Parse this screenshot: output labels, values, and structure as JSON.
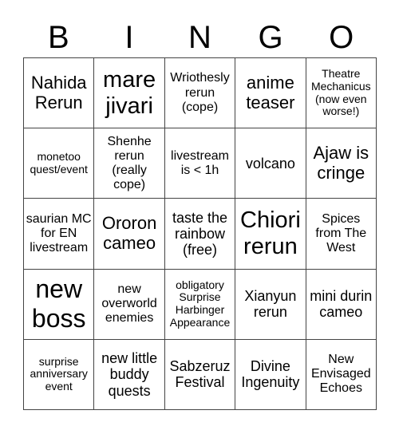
{
  "header": [
    "B",
    "I",
    "N",
    "G",
    "O"
  ],
  "cells": [
    {
      "text": "Nahida Rerun",
      "size": "s4"
    },
    {
      "text": "mare jivari",
      "size": "s5"
    },
    {
      "text": "Wriothesly rerun (cope)",
      "size": "s2"
    },
    {
      "text": "anime teaser",
      "size": "s4"
    },
    {
      "text": "Theatre Mechanicus (now even worse!)",
      "size": "s1"
    },
    {
      "text": "monetoo quest/event",
      "size": "s1"
    },
    {
      "text": "Shenhe rerun (really cope)",
      "size": "s2"
    },
    {
      "text": "livestream is < 1h",
      "size": "s2"
    },
    {
      "text": "volcano",
      "size": "s3"
    },
    {
      "text": "Ajaw is cringe",
      "size": "s4"
    },
    {
      "text": "saurian MC for EN livestream",
      "size": "s2"
    },
    {
      "text": "Ororon cameo",
      "size": "s4"
    },
    {
      "text": "taste the rainbow (free)",
      "size": "s3"
    },
    {
      "text": "Chiori rerun",
      "size": "s5"
    },
    {
      "text": "Spices from The West",
      "size": "s2"
    },
    {
      "text": "new boss",
      "size": "s6"
    },
    {
      "text": "new overworld enemies",
      "size": "s2"
    },
    {
      "text": "obligatory Surprise Harbinger Appearance",
      "size": "s1"
    },
    {
      "text": "Xianyun rerun",
      "size": "s3"
    },
    {
      "text": "mini durin cameo",
      "size": "s3"
    },
    {
      "text": "surprise anniversary event",
      "size": "s1"
    },
    {
      "text": "new little buddy quests",
      "size": "s3"
    },
    {
      "text": "Sabzeruz Festival",
      "size": "s3"
    },
    {
      "text": "Divine Ingenuity",
      "size": "s3"
    },
    {
      "text": "New Envisaged Echoes",
      "size": "s2"
    }
  ]
}
